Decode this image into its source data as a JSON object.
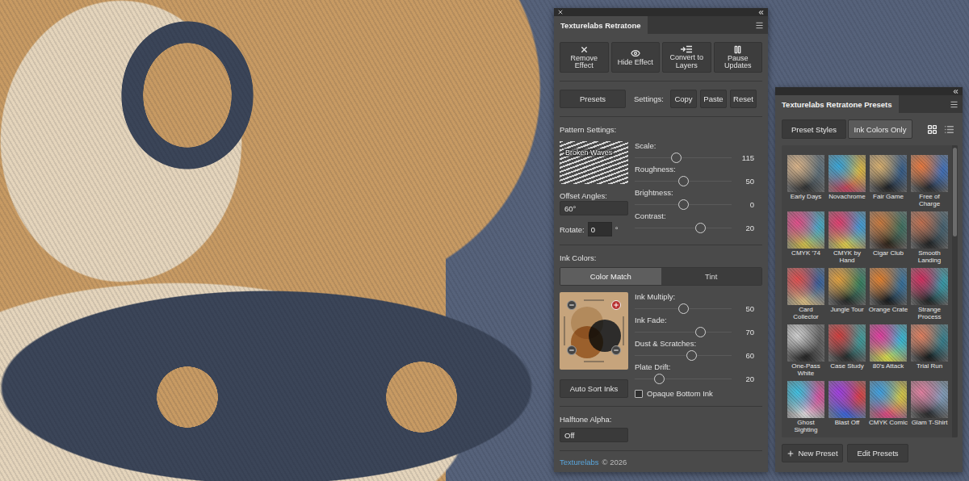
{
  "main_panel": {
    "tab": "Texturelabs Retratone",
    "toolbar": [
      {
        "label": "Remove Effect",
        "kind": "remove"
      },
      {
        "label": "Hide Effect",
        "kind": "hide"
      },
      {
        "label": "Convert to Layers",
        "kind": "convert"
      },
      {
        "label": "Pause Updates",
        "kind": "pause"
      }
    ],
    "presets_button": "Presets",
    "settings_label": "Settings:",
    "settings_buttons": [
      "Copy",
      "Paste",
      "Reset"
    ],
    "pattern": {
      "heading": "Pattern Settings:",
      "name": "Broken Waves",
      "offset_label": "Offset Angles:",
      "offset_value": "60°",
      "rotate_label": "Rotate:",
      "rotate_value": "0",
      "rotate_unit": "°",
      "sliders": [
        {
          "label": "Scale:",
          "value": "115",
          "level": 0.42
        },
        {
          "label": "Roughness:",
          "value": "50",
          "level": 0.5
        },
        {
          "label": "Brightness:",
          "value": "0",
          "level": 0.5
        },
        {
          "label": "Contrast:",
          "value": "20",
          "level": 0.7
        }
      ]
    },
    "inks": {
      "heading": "Ink Colors:",
      "tabs": [
        {
          "label": "Color Match",
          "selected": true
        },
        {
          "label": "Tint",
          "selected": false
        }
      ],
      "swatches": [
        {
          "color": "#e6d6bd"
        },
        {
          "color": "#c8955a"
        },
        {
          "color": "#394457"
        }
      ],
      "sliders": [
        {
          "label": "Ink Multiply:",
          "value": "50",
          "level": 0.5
        },
        {
          "label": "Ink Fade:",
          "value": "70",
          "level": 0.7
        },
        {
          "label": "Dust & Scratches:",
          "value": "60",
          "level": 0.6
        },
        {
          "label": "Plate Drift:",
          "value": "20",
          "level": 0.22
        }
      ],
      "auto_sort": "Auto Sort Inks",
      "opaque": {
        "label": "Opaque Bottom Ink",
        "checked": false
      }
    },
    "alpha": {
      "label": "Halftone Alpha:",
      "value": "Off"
    },
    "footer": {
      "brand": "Texturelabs",
      "copyright": "© 2026"
    }
  },
  "presets_panel": {
    "tab": "Texturelabs Retratone Presets",
    "filters": [
      {
        "label": "Preset Styles",
        "selected": true
      },
      {
        "label": "Ink Colors Only",
        "selected": false
      }
    ],
    "views": [
      {
        "kind": "grid",
        "selected": true
      },
      {
        "kind": "list",
        "selected": false
      }
    ],
    "presets": [
      {
        "name": "Early Days",
        "colors": [
          "#d9b48a",
          "#5a6e7a",
          "#2a2a2a"
        ]
      },
      {
        "name": "Novachrome",
        "colors": [
          "#3aa6d8",
          "#e8c040",
          "#c03a5a"
        ]
      },
      {
        "name": "Fair Game",
        "colors": [
          "#d8b070",
          "#2f5a8a",
          "#1a1a1a"
        ]
      },
      {
        "name": "Free of Charge",
        "colors": [
          "#e87a40",
          "#3a70c0",
          "#222222"
        ]
      },
      {
        "name": "CMYK '74",
        "colors": [
          "#e0508a",
          "#40b0d0",
          "#d8c040"
        ]
      },
      {
        "name": "CMYK by Hand",
        "colors": [
          "#e04070",
          "#3aa0e0",
          "#e8d040"
        ]
      },
      {
        "name": "Cigar Club",
        "colors": [
          "#c87a40",
          "#3a7060",
          "#2a1a10"
        ]
      },
      {
        "name": "Smooth Landing",
        "colors": [
          "#c07050",
          "#406070",
          "#1a1a1a"
        ]
      },
      {
        "name": "Card Collector",
        "colors": [
          "#e05050",
          "#3060a0",
          "#e0c080"
        ]
      },
      {
        "name": "Jungle Tour",
        "colors": [
          "#e0a040",
          "#308060",
          "#202020"
        ]
      },
      {
        "name": "Orange Crate",
        "colors": [
          "#e08030",
          "#3070a0",
          "#101010"
        ]
      },
      {
        "name": "Strange Process",
        "colors": [
          "#d03060",
          "#30a0b0",
          "#1a1a1a"
        ]
      },
      {
        "name": "One-Pass White",
        "colors": [
          "#d0d0d0",
          "#606060",
          "#1a1a1a"
        ]
      },
      {
        "name": "Case Study",
        "colors": [
          "#d04040",
          "#3aa0a0",
          "#202020"
        ]
      },
      {
        "name": "80's Attack",
        "colors": [
          "#e040a0",
          "#30c0e0",
          "#e0e040"
        ]
      },
      {
        "name": "Trial Run",
        "colors": [
          "#e08060",
          "#308090",
          "#101010"
        ]
      },
      {
        "name": "Ghost Sighting",
        "colors": [
          "#40c0e0",
          "#e050a0",
          "#e0e0e0"
        ]
      },
      {
        "name": "Blast Off",
        "colors": [
          "#a040e0",
          "#e04040",
          "#3060e0"
        ]
      },
      {
        "name": "CMYK Comic",
        "colors": [
          "#40a0e0",
          "#e0d040",
          "#e04080"
        ]
      },
      {
        "name": "Glam T-Shirt",
        "colors": [
          "#e080a0",
          "#80a0c0",
          "#202020"
        ]
      }
    ],
    "buttons": [
      {
        "label": "New Preset",
        "kind": "add"
      },
      {
        "label": "Edit Presets",
        "kind": "plain"
      }
    ]
  }
}
